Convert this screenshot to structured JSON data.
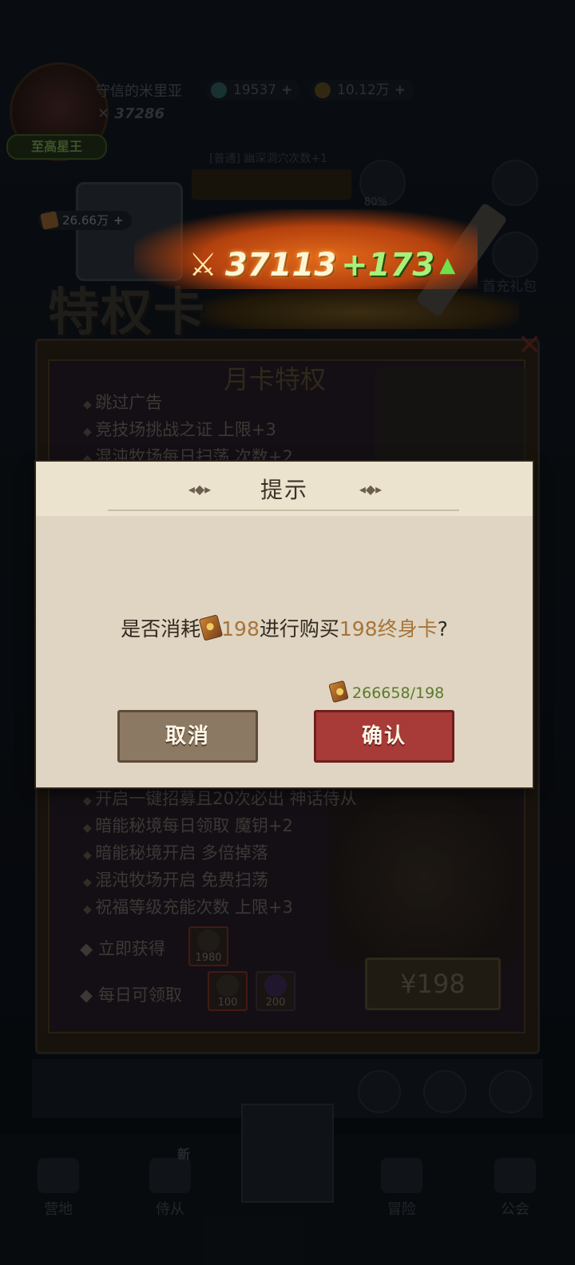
{
  "player": {
    "name": "守信的米里亚",
    "power": "37286",
    "rank_badge": "至高星王"
  },
  "resources": {
    "gems": "19537",
    "coins": "10.12万",
    "tickets": "26.66万"
  },
  "notice": "[普通] 幽深洞穴次数+1",
  "bottleneck_pct": "80%",
  "power_banner": {
    "value": "37113",
    "increase": "+173"
  },
  "first_recharge_label": "首充礼包",
  "page_title": "特权卡",
  "month_card": {
    "title": "月卡特权",
    "perks": [
      "跳过广告",
      "竞技场挑战之证 上限+3",
      "混沌牧场每日扫荡 次数+2"
    ]
  },
  "lifetime_card": {
    "perks": [
      "开启一键招募且20次必出 神话侍从",
      "暗能秘境每日领取 魔钥+2",
      "暗能秘境开启 多倍掉落",
      "混沌牧场开启 免费扫荡",
      "祝福等级充能次数 上限+3"
    ],
    "instant_label": "立即获得",
    "instant_items": [
      {
        "icon": "skull-coin-icon",
        "count": "1980"
      }
    ],
    "daily_label": "每日可领取",
    "daily_items": [
      {
        "icon": "skull-coin-icon",
        "count": "100"
      },
      {
        "icon": "purple-orb-icon",
        "count": "200"
      }
    ],
    "price": "¥198"
  },
  "nav": {
    "items": [
      "营地",
      "侍从",
      "",
      "冒险",
      "公会"
    ],
    "new_badge": "新"
  },
  "dialog": {
    "title": "提示",
    "message_prefix": "是否消耗",
    "cost": "198",
    "message_mid": "进行购买",
    "product": "198终身卡",
    "message_suffix": "?",
    "balance": "266658/198",
    "cancel_label": "取消",
    "confirm_label": "确认"
  },
  "colors": {
    "dialog_bg": "#dfd5c2",
    "highlight": "#a8743a",
    "confirm": "#a83a38",
    "cancel": "#8c7963",
    "balance_text": "#5a7a2a"
  }
}
